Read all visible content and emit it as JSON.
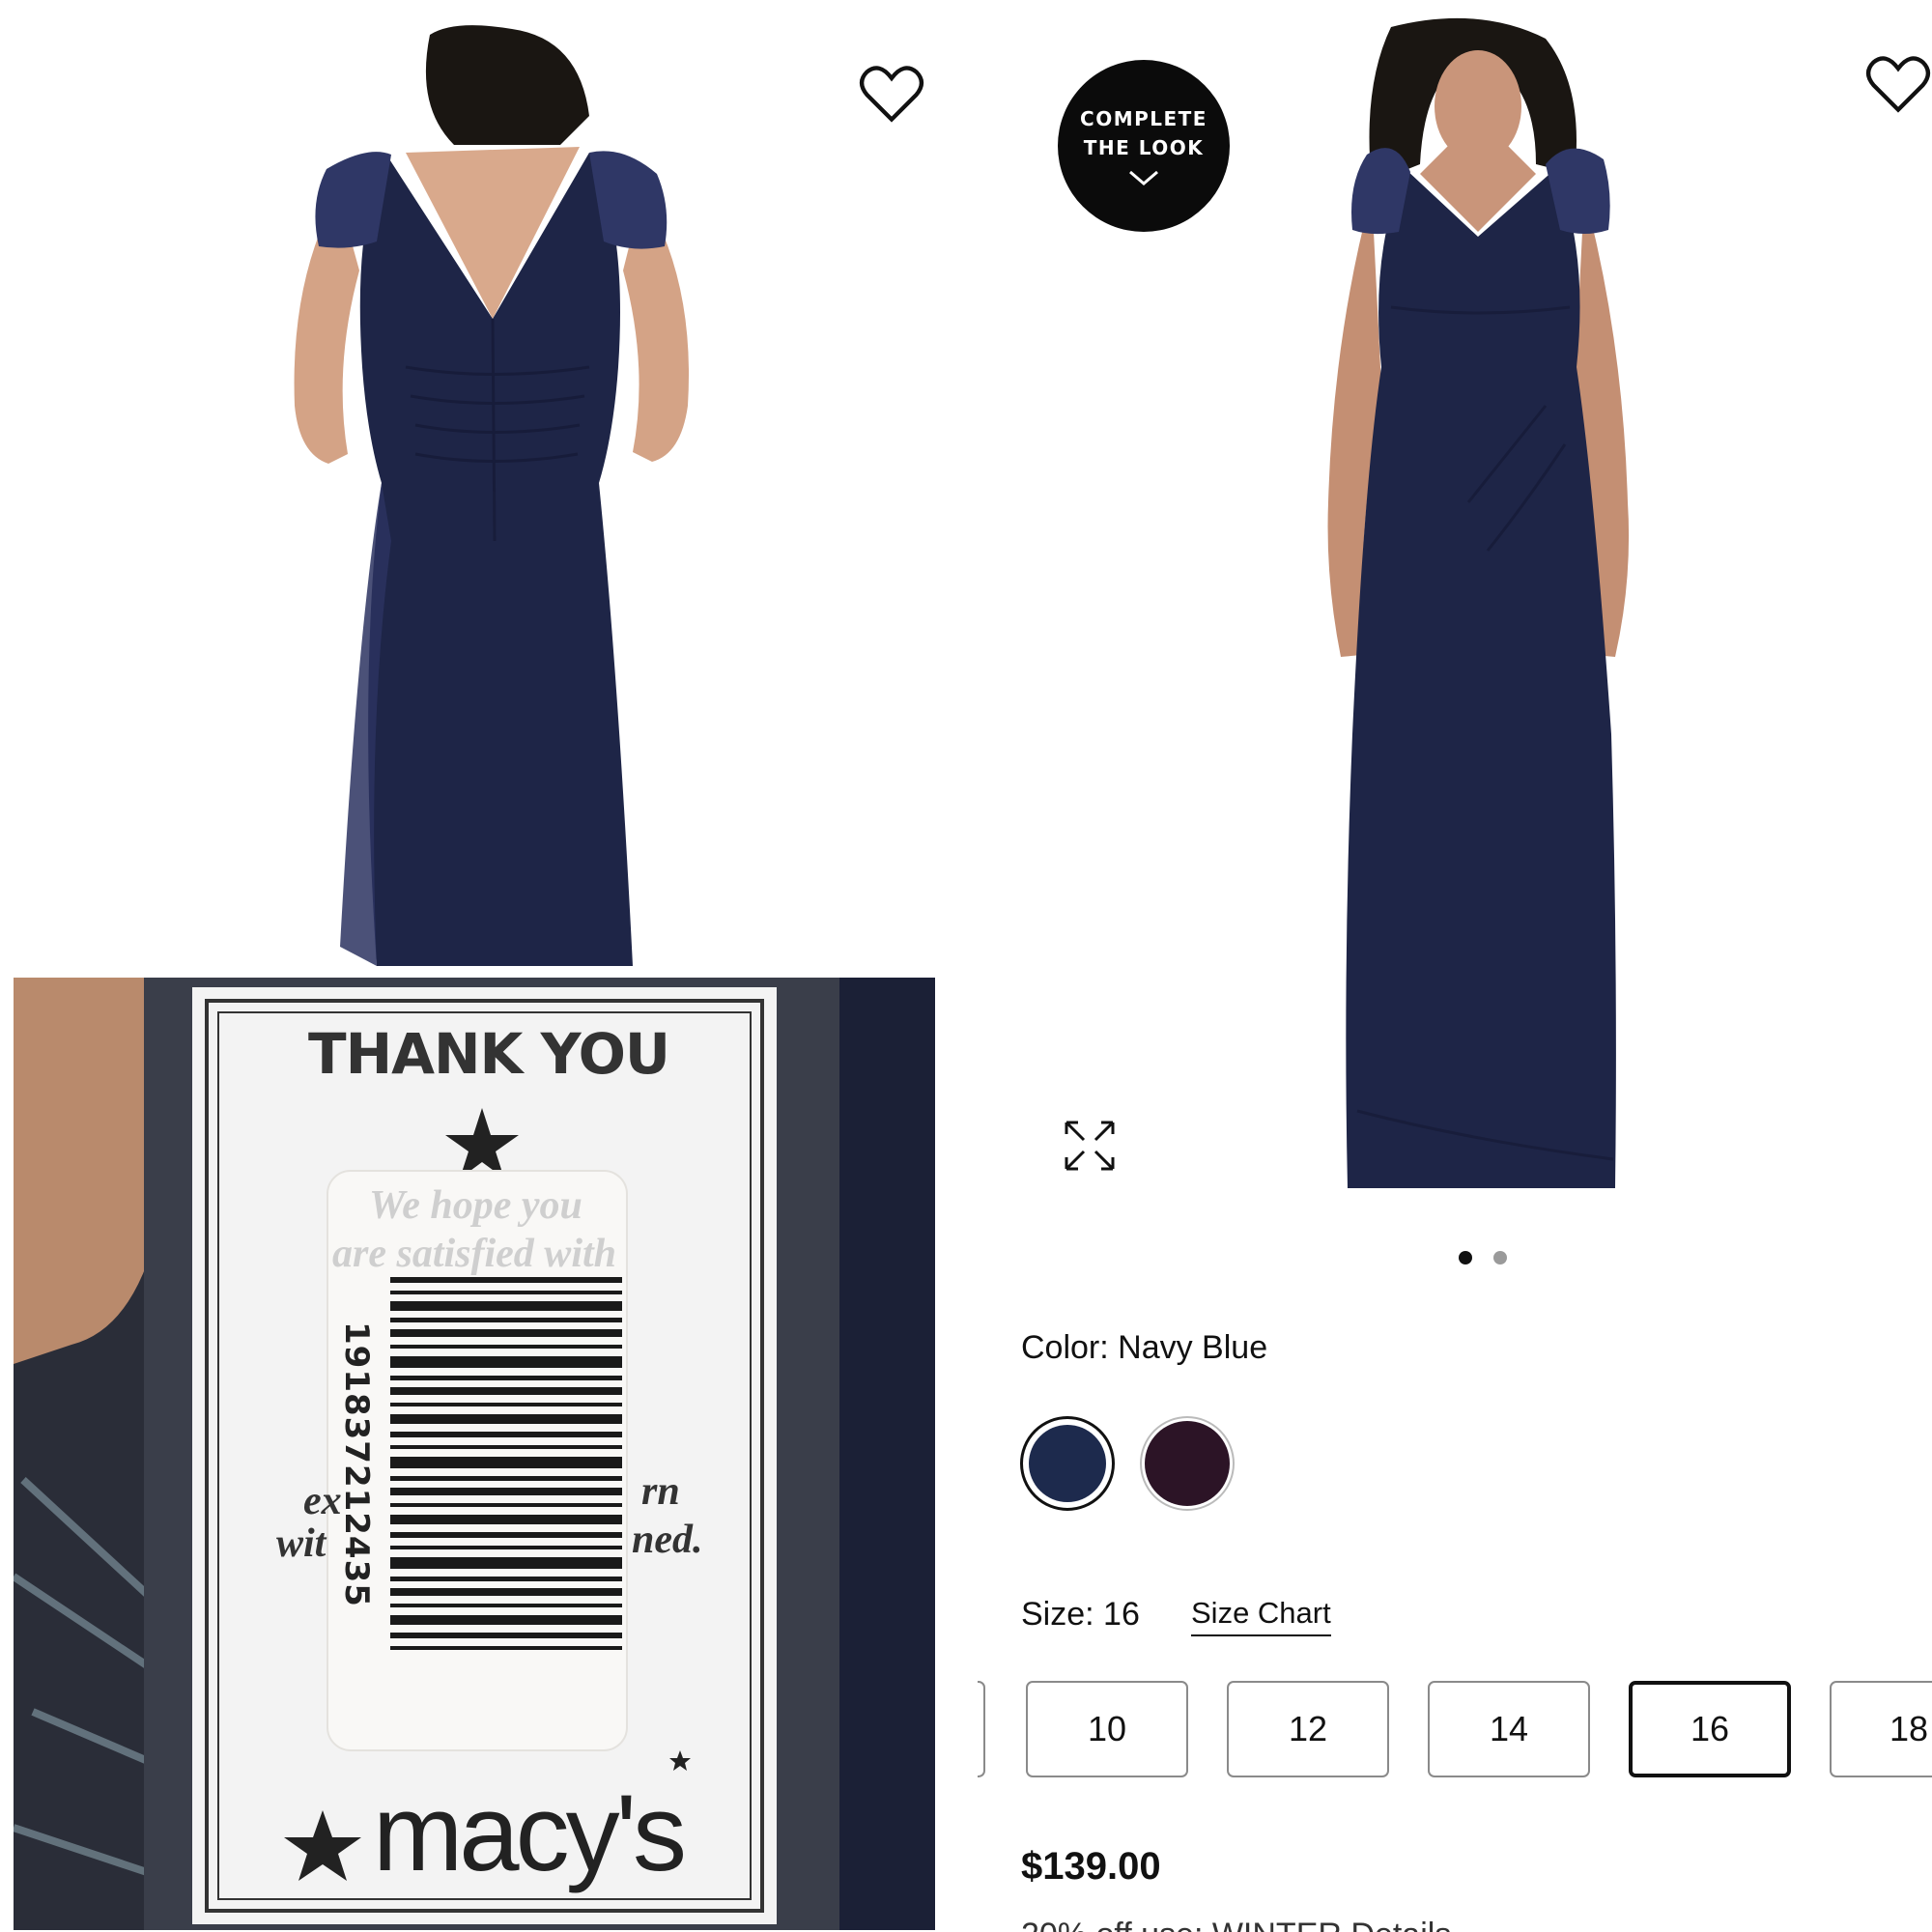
{
  "product": {
    "color_label": "Color: Navy Blue",
    "colors": [
      {
        "name": "Navy Blue",
        "hex": "#1d2a4d",
        "selected": true
      },
      {
        "name": "Plum",
        "hex": "#2c1426",
        "selected": false
      }
    ],
    "size_label": "Size: 16",
    "size_chart_link": "Size Chart",
    "sizes": [
      "10",
      "12",
      "14",
      "16",
      "18"
    ],
    "selected_size": "16",
    "price": "$139.00",
    "promo_partial": "20% off use: WINTER  Details"
  },
  "gallery": {
    "complete_look_line1": "COMPLETE",
    "complete_look_line2": "THE LOOK",
    "dots": [
      {
        "active": true
      },
      {
        "active": false
      }
    ],
    "dress_color": "#1e2547"
  },
  "tag": {
    "heading": "THANK YOU",
    "faded_line1": "We hope you",
    "faded_line2": "are satisfied with",
    "left_partial1": "ex",
    "left_partial2": "wit",
    "right_partial1": "rn",
    "right_partial2": "ned.",
    "barcode_number": "191837212435",
    "brand": "macy's"
  },
  "colors": {
    "accent": "#111111",
    "border_default": "#8a8a8a",
    "dot_active": "#111111",
    "dot_inactive": "#9a9a9a"
  }
}
